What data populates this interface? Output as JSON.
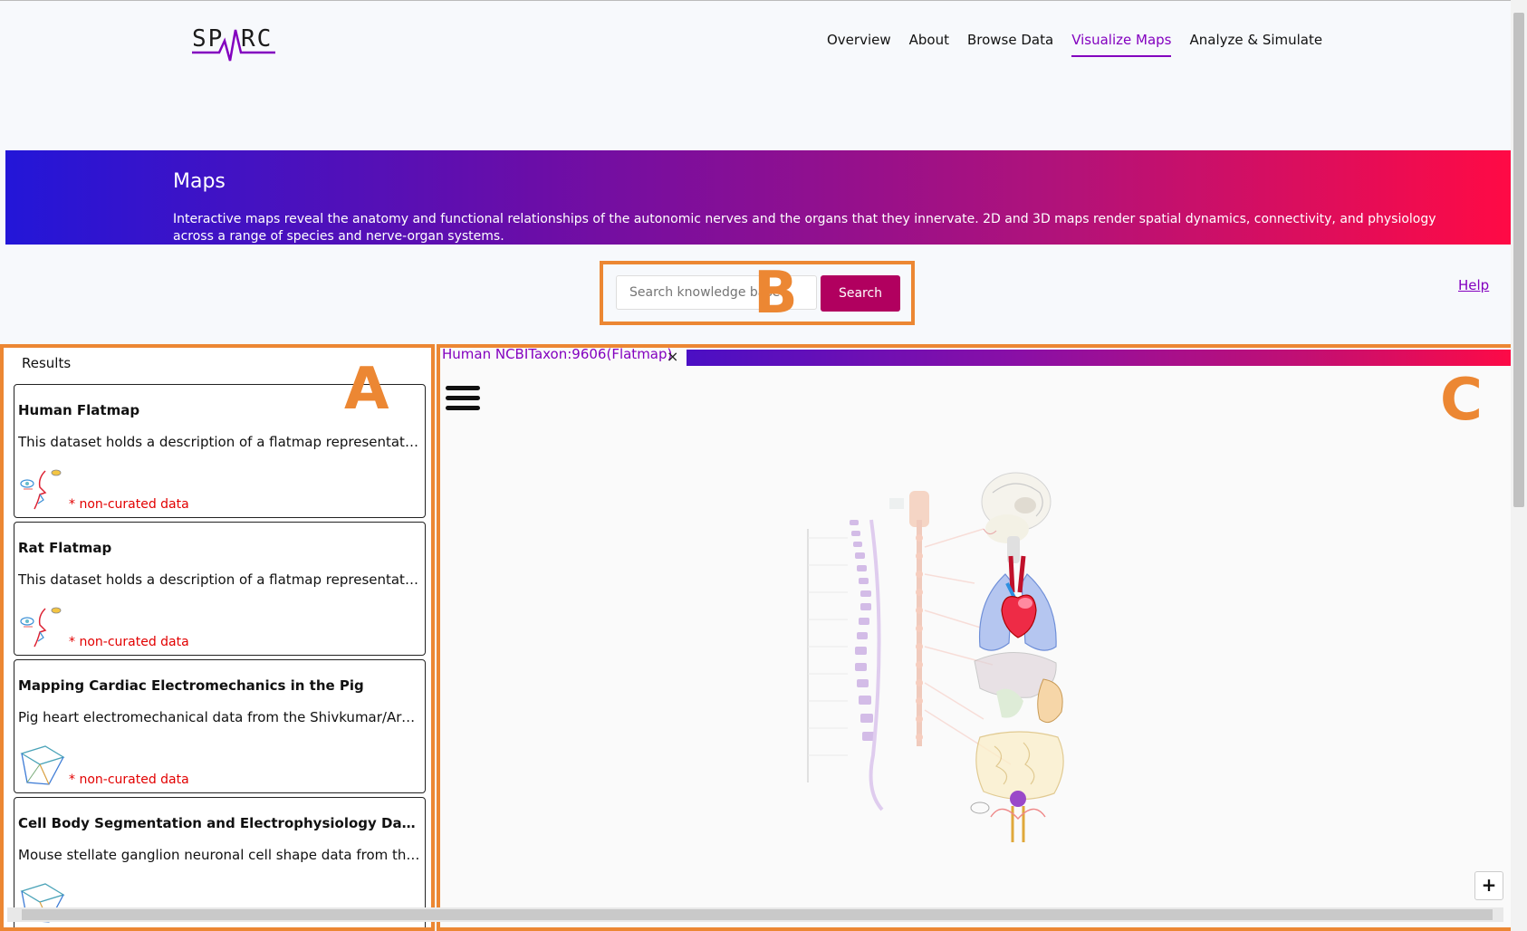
{
  "header": {
    "logo_text": "SPARC",
    "nav": [
      {
        "label": "Overview",
        "active": false
      },
      {
        "label": "About",
        "active": false
      },
      {
        "label": "Browse Data",
        "active": false
      },
      {
        "label": "Visualize Maps",
        "active": true
      },
      {
        "label": "Analyze & Simulate",
        "active": false
      }
    ]
  },
  "banner": {
    "title": "Maps",
    "description": "Interactive maps reveal the anatomy and functional relationships of the autonomic nerves and the organs that they innervate. 2D and 3D maps render spatial dynamics, connectivity, and physiology across a range of species and nerve-organ systems."
  },
  "search": {
    "placeholder": "Search knowledge base",
    "button_label": "Search"
  },
  "help": {
    "label": "Help"
  },
  "annotations": {
    "a": "A",
    "b": "B",
    "c": "C"
  },
  "results": {
    "title": "Results",
    "items": [
      {
        "title": "Human Flatmap",
        "description": "This dataset holds a description of a flatmap representation of the human body.",
        "note": "* non-curated data",
        "thumb": "face-sketch-icon"
      },
      {
        "title": "Rat Flatmap",
        "description": "This dataset holds a description of a flatmap representation of the rat body.",
        "note": "* non-curated data",
        "thumb": "face-sketch-icon"
      },
      {
        "title": "Mapping Cardiac Electromechanics in the Pig",
        "description": "Pig heart electromechanical data from the Shivkumar/Ardell labs",
        "note": "* non-curated data",
        "thumb": "cube-icon"
      },
      {
        "title": "Cell Body Segmentation and Electrophysiology Data: Stellate ganglion",
        "description": "Mouse stellate ganglion neuronal cell shape data from the lab",
        "note": "",
        "thumb": "cube-icon"
      }
    ]
  },
  "viewer": {
    "tab_label": "Human NCBITaxon:9606(Flatmap)",
    "tab_close": "×",
    "zoom_in": "+"
  },
  "colors": {
    "accent": "#8300bf",
    "search_button": "#b1005f",
    "annotation": "#ec8733",
    "warning": "#e20000"
  }
}
